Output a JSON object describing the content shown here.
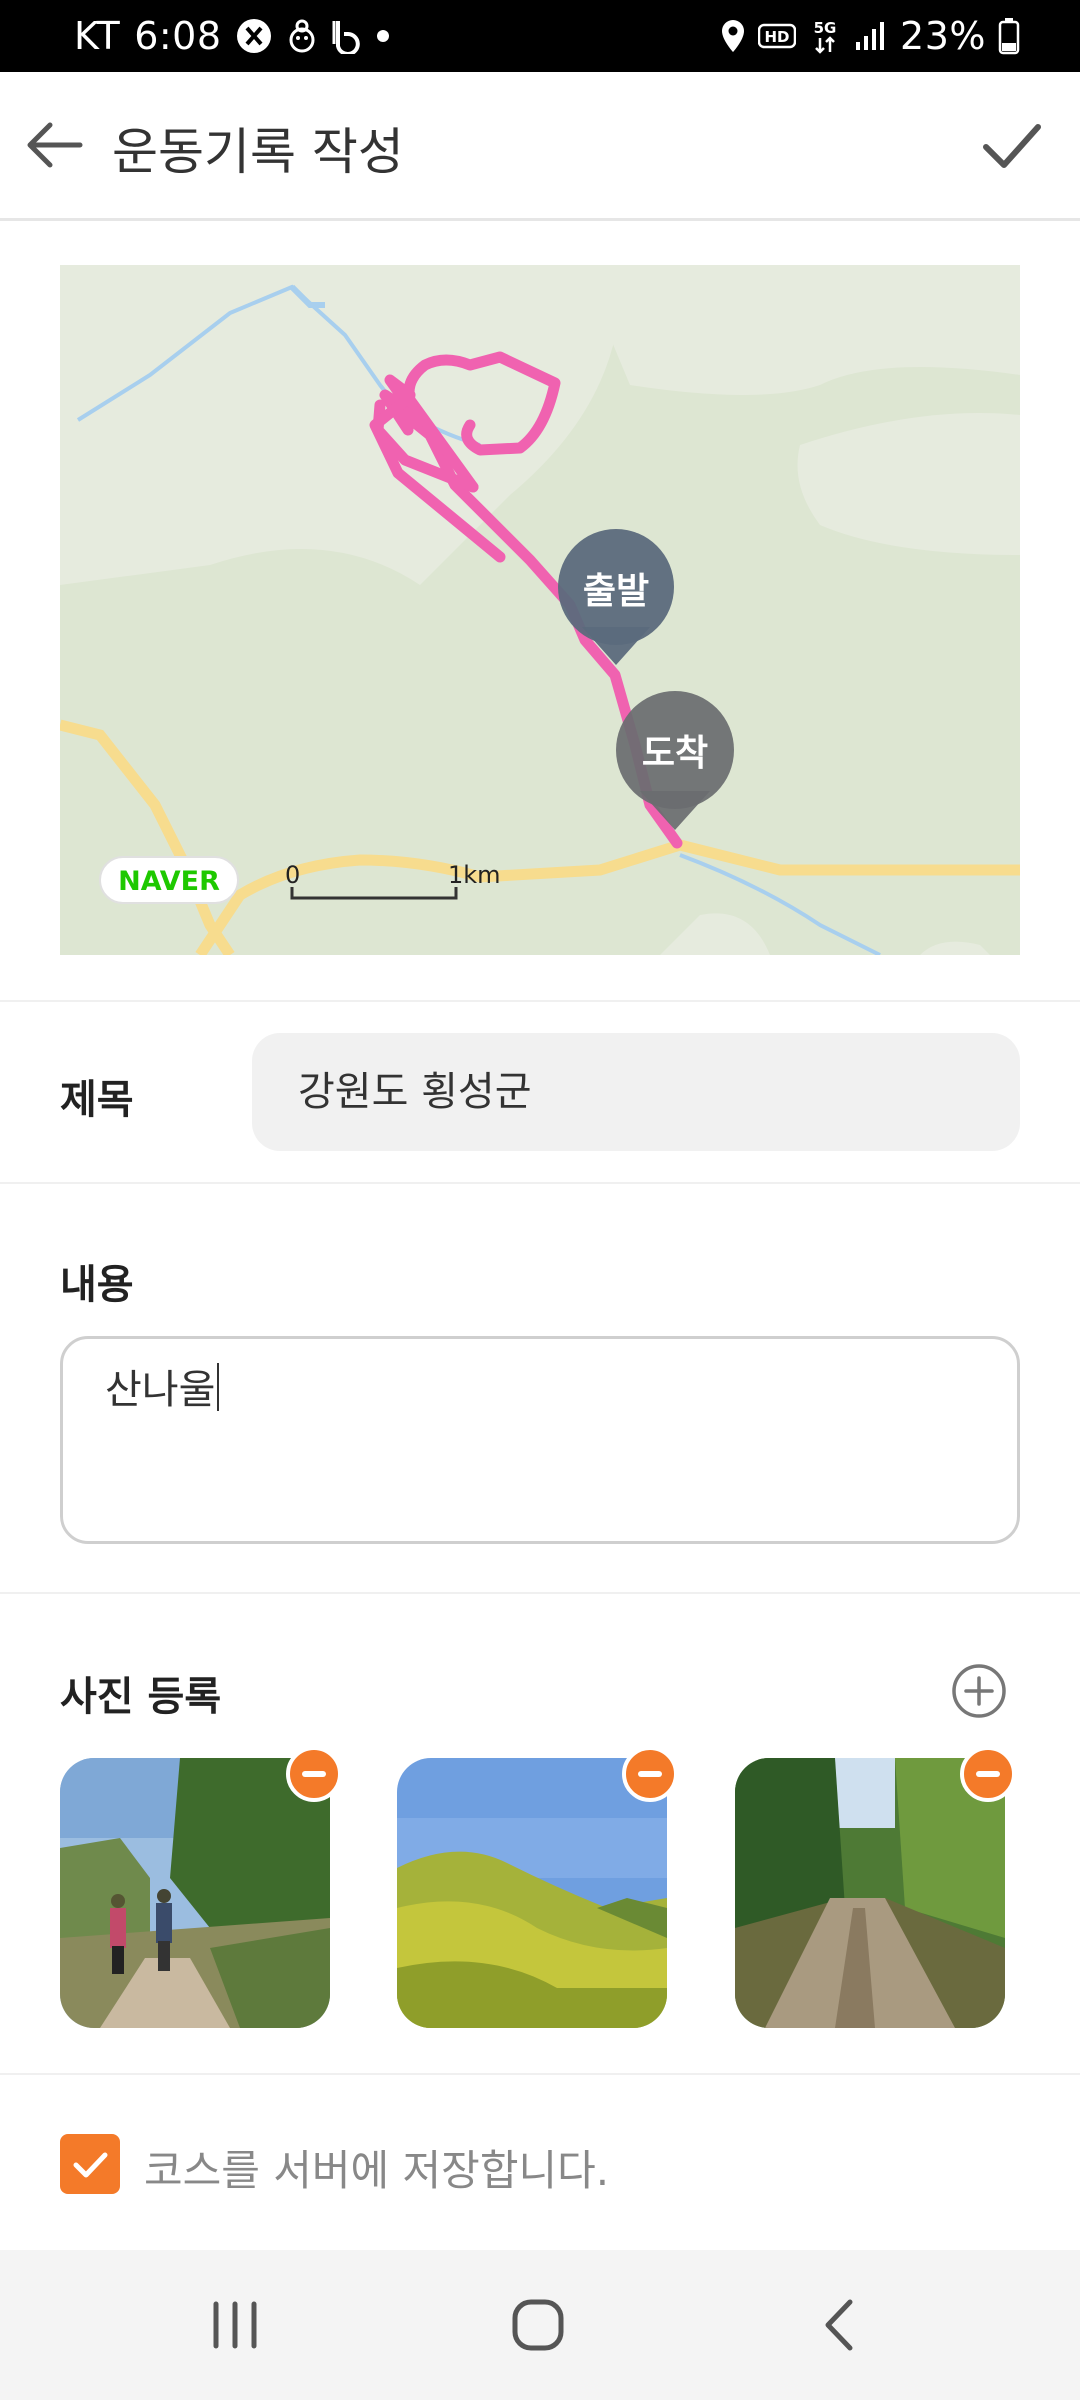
{
  "status_bar": {
    "carrier": "KT",
    "time": "6:08",
    "network_hd": "HD",
    "network_5g": "5G",
    "battery": "23%"
  },
  "header": {
    "title": "운동기록 작성"
  },
  "map": {
    "start_label": "출발",
    "end_label": "도착",
    "provider": "NAVER",
    "scale_start": "0",
    "scale_end": "1km"
  },
  "form": {
    "title_label": "제목",
    "title_value": "강원도 횡성군",
    "content_label": "내용",
    "content_value": "산나울",
    "photos_label": "사진 등록",
    "save_course_label": "코스를 서버에 저장합니다.",
    "save_course_checked": true
  },
  "colors": {
    "accent": "#f47a29",
    "route": "#f062b0"
  }
}
